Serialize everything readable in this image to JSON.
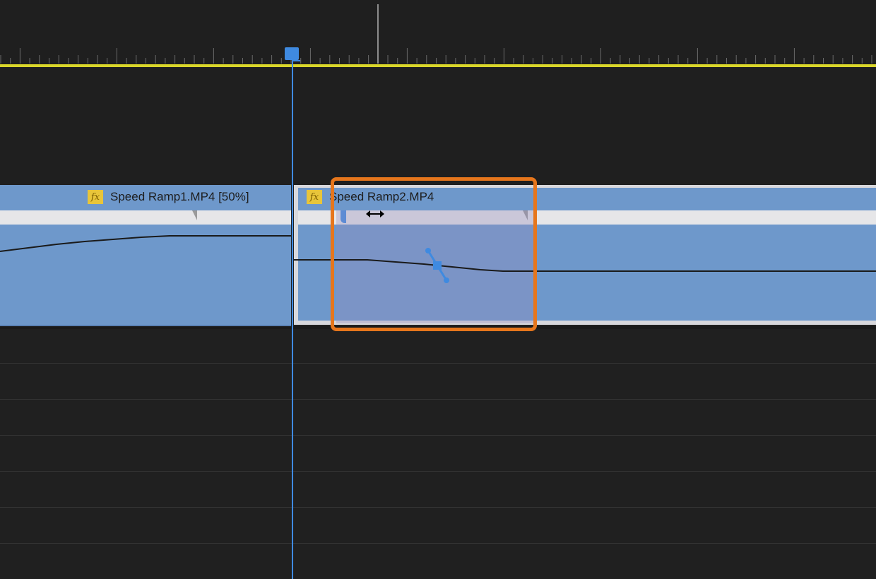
{
  "timeline": {
    "clips": [
      {
        "name": "Speed Ramp1.MP4 [50%]",
        "fx_label": "fx"
      },
      {
        "name": "Speed Ramp2.MP4",
        "fx_label": "fx"
      }
    ]
  },
  "icons": {
    "fx": "fx-badge-icon",
    "playhead": "playhead-handle-icon",
    "resize_cursor": "horizontal-resize-cursor-icon",
    "keyframe": "speed-keyframe-handle-icon"
  },
  "colors": {
    "clip": "#6e98cb",
    "playhead": "#3f8ae0",
    "work_area": "#d9d62a",
    "highlight": "#e6761c",
    "fx_badge": "#e8c53a"
  }
}
